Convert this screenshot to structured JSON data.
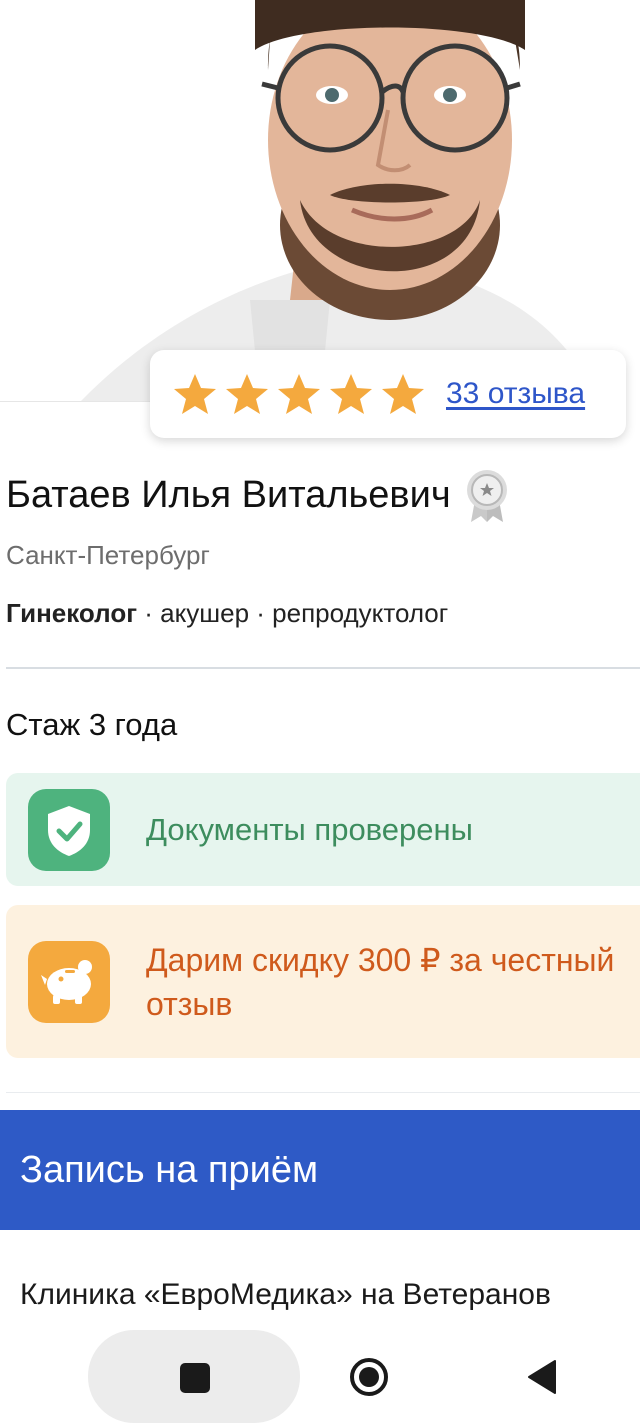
{
  "doctor": {
    "name": "Батаев Илья Витальевич",
    "city": "Санкт-Петербург",
    "primary_specialty": "Гинеколог",
    "other_specialties": " · акушер · репродуктолог",
    "experience": "Стаж 3 года",
    "photo_icon": "doctor-photo",
    "badge_icon": "medal-badge-icon"
  },
  "rating": {
    "stars": 5,
    "max_stars": 5,
    "reviews_label": "33 отзыва",
    "star_color": "#f4a93e"
  },
  "documents": {
    "label": "Документы проверены",
    "icon": "shield-check-icon",
    "accent": "#4eb37e"
  },
  "promo": {
    "line1": "Дарим скидку 300 ₽ за честный",
    "line2": "отзыв",
    "icon": "piggy-bank-icon",
    "accent": "#f4a93e",
    "text_color": "#cf5a1c"
  },
  "booking": {
    "title": "Запись на приём",
    "color": "#2e5ac6"
  },
  "clinic": {
    "name": "Клиника «ЕвроМедика» на Ветеранов"
  },
  "navbar": {
    "recents_icon": "square-icon",
    "home_icon": "circle-home-icon",
    "back_icon": "triangle-back-icon"
  }
}
